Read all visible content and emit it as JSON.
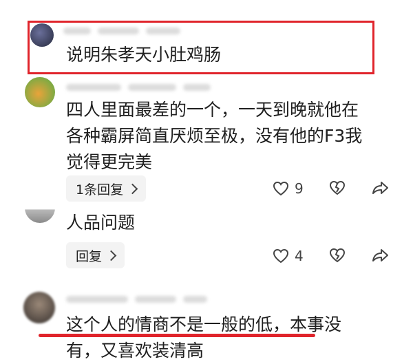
{
  "comments": [
    {
      "text": "说明朱孝天小肚鸡肠"
    },
    {
      "text": "四人里面最差的一个，一天到晚就他在各种霸屏简直厌烦至极，没有他的F3我觉得更完美",
      "lines": [
        "四人里面最差的一个，一天到晚就他在",
        "各种霸屏简直厌烦至极，没有他的F3我",
        "觉得更完美"
      ],
      "reply_label": "1条回复",
      "likes": "9"
    },
    {
      "text": "人品问题",
      "reply_label": "回复",
      "likes": "4"
    },
    {
      "text": "这个人的情商不是一般的低，本事没有，又喜欢装清高",
      "lines": [
        "这个人的情商不是一般的低，本事没",
        "有，又喜欢装清高"
      ]
    }
  ],
  "icons": {
    "like": "heart-icon",
    "dislike": "broken-heart-icon",
    "share": "share-icon",
    "reply_chevron": "chevron-right-icon"
  },
  "colors": {
    "highlight": "#e0242b",
    "pill_bg": "#f3f3f3"
  }
}
